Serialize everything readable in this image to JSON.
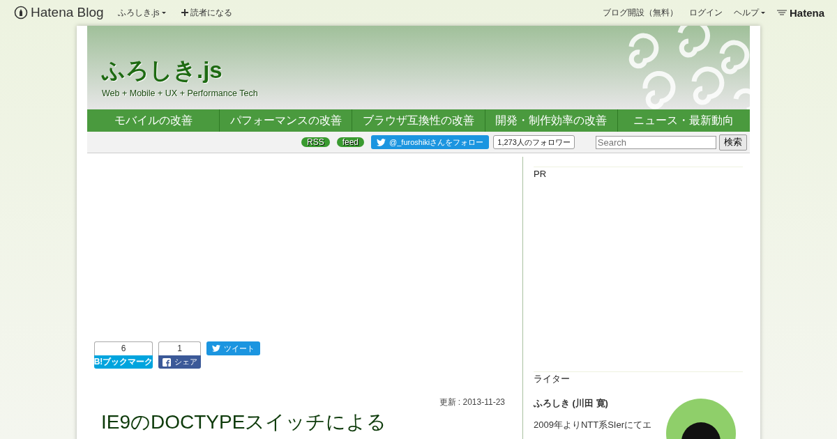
{
  "global_header": {
    "logo": "Hatena Blog",
    "blog_menu": "ふろしき.js",
    "subscribe": "読者になる",
    "right_links": [
      "ブログ開設（無料）",
      "ログイン"
    ],
    "help": "ヘルプ",
    "hatena_logo": "Hatena"
  },
  "blog": {
    "title": "ふろしき.js",
    "description": "Web + Mobile + UX + Performance Tech",
    "nav": [
      "モバイルの改善",
      "パフォーマンスの改善",
      "ブラウザ互換性の改善",
      "開発・制作効率の改善",
      "ニュース・最新動向"
    ],
    "subbar": {
      "rss": "RSS",
      "feed": "feed",
      "follow": "@_furoshikiさんをフォロー",
      "followers": "1,273人のフォロワー",
      "search": {
        "placeholder": "Search"
      },
      "search_button": "検索"
    }
  },
  "share": {
    "bookmark_count": "6",
    "bookmark_label": "B!ブックマーク",
    "facebook_count": "1",
    "facebook_label": "シェア",
    "tweet_label": "ツイート"
  },
  "entry": {
    "updated": "更新 : 2013-11-23",
    "title": "IE9のDOCTYPEスイッチによる"
  },
  "sidebar": [
    {
      "title": "PR"
    },
    {
      "title": "ライター",
      "name": "ふろしき (川田 寛)",
      "bio": "2009年よりNTT系SIerにてエ"
    }
  ]
}
